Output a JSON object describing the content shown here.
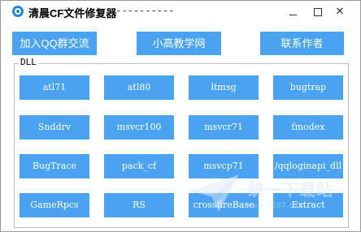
{
  "window": {
    "title": "清晨CF文件修复器",
    "title_suffix": "-----------"
  },
  "top_buttons": [
    {
      "label": "加入QQ群交流"
    },
    {
      "label": "小高教学网"
    },
    {
      "label": "联系作者"
    }
  ],
  "group": {
    "label": "DLL"
  },
  "dll_buttons": [
    {
      "label": "atl71"
    },
    {
      "label": "atl80"
    },
    {
      "label": "ltmsg"
    },
    {
      "label": "bugtrap"
    },
    {
      "label": "Snddrv"
    },
    {
      "label": "msvcr100"
    },
    {
      "label": "msvcr71"
    },
    {
      "label": "fmodex"
    },
    {
      "label": "BugTrace"
    },
    {
      "label": "pack_cf"
    },
    {
      "label": "msvcp71"
    },
    {
      "label": "/qqloginapi_dll"
    },
    {
      "label": "GameRpcs"
    },
    {
      "label": "RS"
    },
    {
      "label": "crossfireBase"
    },
    {
      "label": "Extract"
    }
  ],
  "watermark": {
    "text": "统一下载站",
    "url": "www.3987.com"
  },
  "colors": {
    "button_bg": "#4aa3f0",
    "button_text": "#ffffff",
    "icon_accent": "#1e88d8"
  }
}
